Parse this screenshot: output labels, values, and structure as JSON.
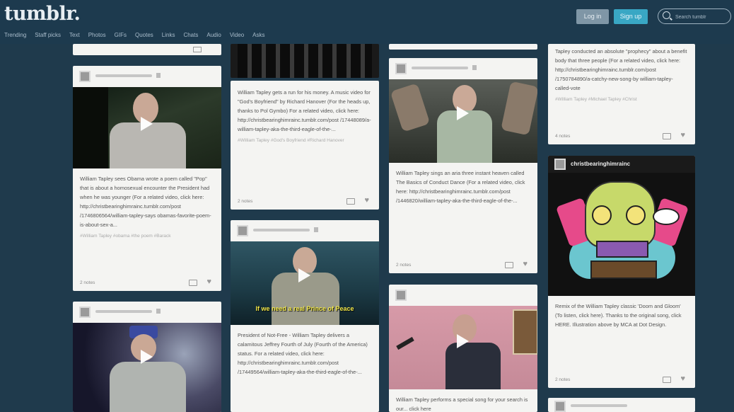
{
  "header": {
    "logo": "tumblr.",
    "nav": [
      "Trending",
      "Staff picks",
      "Text",
      "Photos",
      "GIFs",
      "Quotes",
      "Links",
      "Chats",
      "Audio",
      "Video",
      "Asks"
    ],
    "login_label": "Log in",
    "signup_label": "Sign up",
    "search_placeholder": "Search tumblr"
  },
  "colors": {
    "background": "#1f3a4c",
    "signup": "#39a7c4",
    "login": "#7f96a6",
    "card": "#f4f4f2"
  },
  "posts": [
    {
      "body": "William Tapley sees Obama wrote a poem called \"Pop\" that is about a homosexual encounter the President had when he was younger (For a related video, click here: http://christbearinghimrainc.tumblr.com/post /1746806564/william-tapley-says obamas-favorite-poem-is-about-sex-a...",
      "tags": "#William Tapley  #obama  #the poem  #Barack",
      "notes": "2 notes"
    },
    {
      "body": "William Tapley gets a run for his money. A music video for \"God's Boyfriend\" by Richard Hanover (For the heads up, thanks to Pol Gymbo) For a related video, click here: http://christbearinghimrainc.tumblr.com/post /17448089/a-william-tapley-aka-the-third-eagle-of-the-...",
      "tags": "#William Tapley  #God's Boyfriend  #Richard Hanover",
      "notes": "2 notes"
    },
    {
      "body": "President of Not-Free - William Tapley delivers a calamitous Jeffrey Fourth of July (Fourth of the America) status. For a related video, click here: http://christbearinghimrainc.tumblr.com/post /17449564/william-tapley-aka-the-third-eagle-of-the-...",
      "overlay": "If we need a real Prince of Peace"
    },
    {
      "body": "William Tapley sings an aria three instant heaven called The Basics of Conduct Dance (For a related video, click here: http://christbearinghimrainc.tumblr.com/post /1446820/william-tapley-aka-the-third-eagle-of-the-...",
      "notes": "2 notes"
    },
    {
      "body": "William Tapley performs a special song for your search is our... click here"
    },
    {
      "body": "Tapley conducted an absolute \"prophecy\" about a benefit body that three people (For a related video, click here: http://christbearinghimrainc.tumblr.com/post /1750784890/a-catchy-new-song-by william-tapley-called-vote",
      "tags": "#William Tapley  #Michael Tapley  #Christ",
      "notes": "4 notes"
    },
    {
      "username": "christbearinghimrainc",
      "body": "Remix of the William Tapley classic 'Doom and Gloom' (To listen, click here). Thanks to the original song, click HERE. Illustration above by MCA at Dot Design.",
      "notes": "2 notes"
    }
  ]
}
